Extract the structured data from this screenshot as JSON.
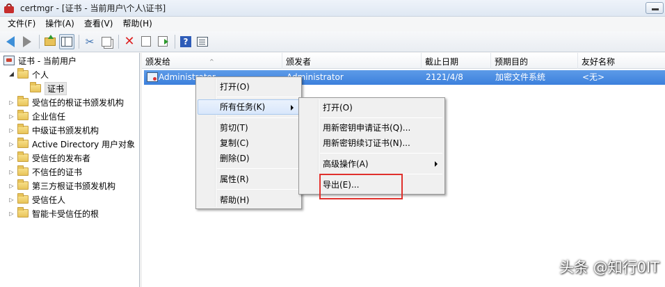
{
  "window": {
    "title": "certmgr - [证书 - 当前用户\\个人\\证书]"
  },
  "menubar": [
    "文件(F)",
    "操作(A)",
    "查看(V)",
    "帮助(H)"
  ],
  "tree": {
    "root": "证书 - 当前用户",
    "personal": "个人",
    "personal_child": "证书",
    "stores": [
      "受信任的根证书颁发机构",
      "企业信任",
      "中级证书颁发机构",
      "Active Directory 用户对象",
      "受信任的发布者",
      "不信任的证书",
      "第三方根证书颁发机构",
      "受信任人",
      "智能卡受信任的根"
    ]
  },
  "list": {
    "columns": [
      "颁发给",
      "颁发者",
      "截止日期",
      "预期目的",
      "友好名称"
    ],
    "rows": [
      {
        "issued_to": "Administrator",
        "issued_by": "Administrator",
        "expires": "2121/4/8",
        "purpose": "加密文件系统",
        "friendly": "<无>"
      }
    ]
  },
  "context_menu": {
    "items": [
      "打开(O)",
      "所有任务(K)",
      "剪切(T)",
      "复制(C)",
      "删除(D)",
      "属性(R)",
      "帮助(H)"
    ]
  },
  "submenu": {
    "items": [
      "打开(O)",
      "用新密钥申请证书(Q)...",
      "用新密钥续订证书(N)...",
      "高级操作(A)",
      "导出(E)..."
    ]
  },
  "watermark": "头条 @知行0IT",
  "colors": {
    "selection": "#3c80dc",
    "highlight_box": "#e0302c"
  }
}
